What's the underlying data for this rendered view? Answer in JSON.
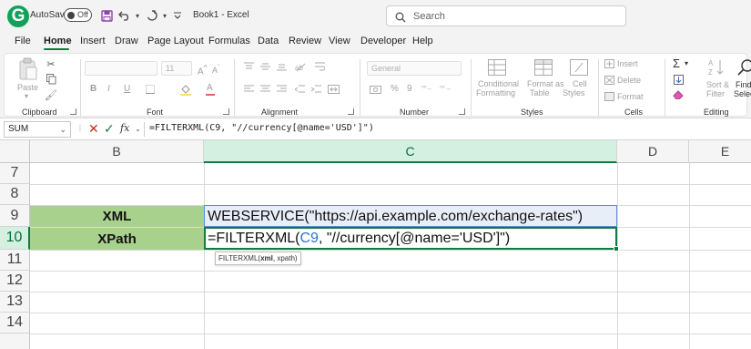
{
  "titlebar": {
    "autosave_label": "AutoSave",
    "autosave_state": "Off",
    "book_title": "Book1  -  Excel",
    "search_placeholder": "Search"
  },
  "tabs": [
    {
      "label": "File"
    },
    {
      "label": "Home",
      "active": true
    },
    {
      "label": "Insert"
    },
    {
      "label": "Draw"
    },
    {
      "label": "Page Layout"
    },
    {
      "label": "Formulas"
    },
    {
      "label": "Data"
    },
    {
      "label": "Review"
    },
    {
      "label": "View"
    },
    {
      "label": "Developer"
    },
    {
      "label": "Help"
    }
  ],
  "ribbon": {
    "clipboard": {
      "label": "Clipboard",
      "paste": "Paste"
    },
    "font": {
      "label": "Font",
      "size": "11"
    },
    "alignment": {
      "label": "Alignment"
    },
    "number": {
      "label": "Number",
      "format": "General"
    },
    "styles": {
      "label": "Styles",
      "conditional": "Conditional",
      "formatting": "Formatting",
      "format_as": "Format as",
      "table": "Table",
      "cell": "Cell",
      "styles_btn": "Styles"
    },
    "cells": {
      "label": "Cells",
      "insert": "Insert",
      "delete": "Delete",
      "format": "Format"
    },
    "editing": {
      "label": "Editing",
      "sort": "Sort &",
      "filter": "Filter",
      "find": "Find &",
      "select": "Select"
    }
  },
  "formula_bar": {
    "name_box": "SUM",
    "formula": "=FILTERXML(C9, \"//currency[@name='USD']\")"
  },
  "columns": [
    "B",
    "C",
    "D",
    "E"
  ],
  "rows": [
    "7",
    "8",
    "9",
    "10",
    "11",
    "12",
    "13",
    "14"
  ],
  "cells": {
    "B9": "XML",
    "C9": "WEBSERVICE(\"https://api.example.com/exchange-rates\")",
    "B10": "XPath",
    "C10_prefix": "=FILTERXML(",
    "C10_ref": "C9",
    "C10_suffix": ", \"//currency[@name='USD']\")"
  },
  "tooltip": {
    "func": "FILTERXML(",
    "arg1": "xml",
    "rest": ", xpath)"
  },
  "colors": {
    "accent": "#107c41",
    "label_fill": "#a9d18e",
    "ref_blue": "#2f6fd6"
  }
}
